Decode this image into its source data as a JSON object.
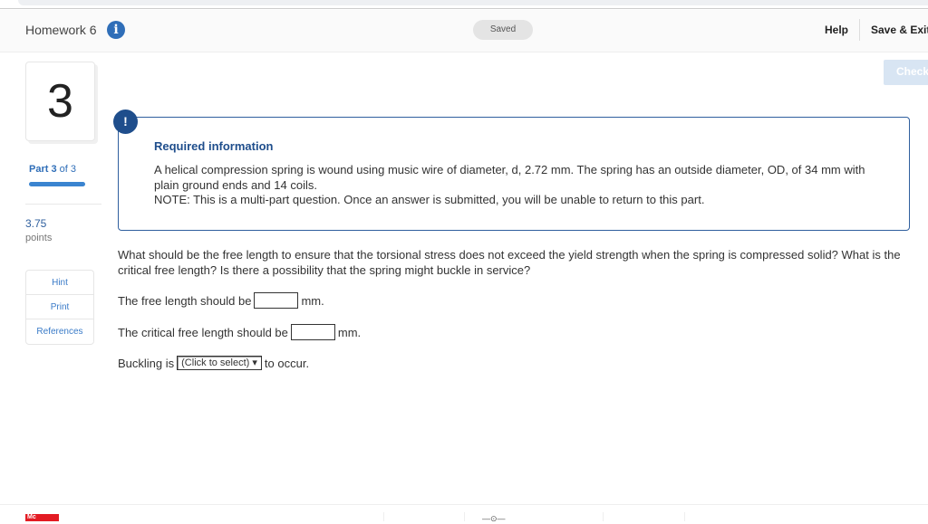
{
  "header": {
    "title": "Homework 6",
    "status": "Saved",
    "help": "Help",
    "save_exit": "Save & Exit"
  },
  "check_label": "Check",
  "question": {
    "number": "3",
    "part_label": "Part",
    "part_current": "3",
    "part_of": "of 3",
    "progress": 1.0,
    "points": "3.75",
    "points_label": "points"
  },
  "tools": [
    "Hint",
    "Print",
    "References"
  ],
  "required": {
    "title": "Required information",
    "text1": "A helical compression spring is wound using music wire of diameter, d, 2.72 mm. The spring has an outside diameter, OD, of 34 mm with plain ground ends and 14 coils.",
    "text2": "NOTE: This is a multi-part question. Once an answer is submitted, you will be unable to return to this part."
  },
  "prompt": "What should be the free length to ensure that the torsional stress does not exceed the yield strength when the spring is compressed solid? What is the critical free length? Is there a possibility that the spring might buckle in service?",
  "answers": {
    "free_length_label": "The free length should be",
    "free_length_value": "",
    "unit1": "mm.",
    "critical_label": "The critical free length should be",
    "critical_value": "",
    "unit2": "mm.",
    "buckling_label": "Buckling is",
    "buckling_select": "(Click to select)",
    "buckling_suffix": "to occur."
  },
  "footer": {
    "logo": "Mc"
  }
}
